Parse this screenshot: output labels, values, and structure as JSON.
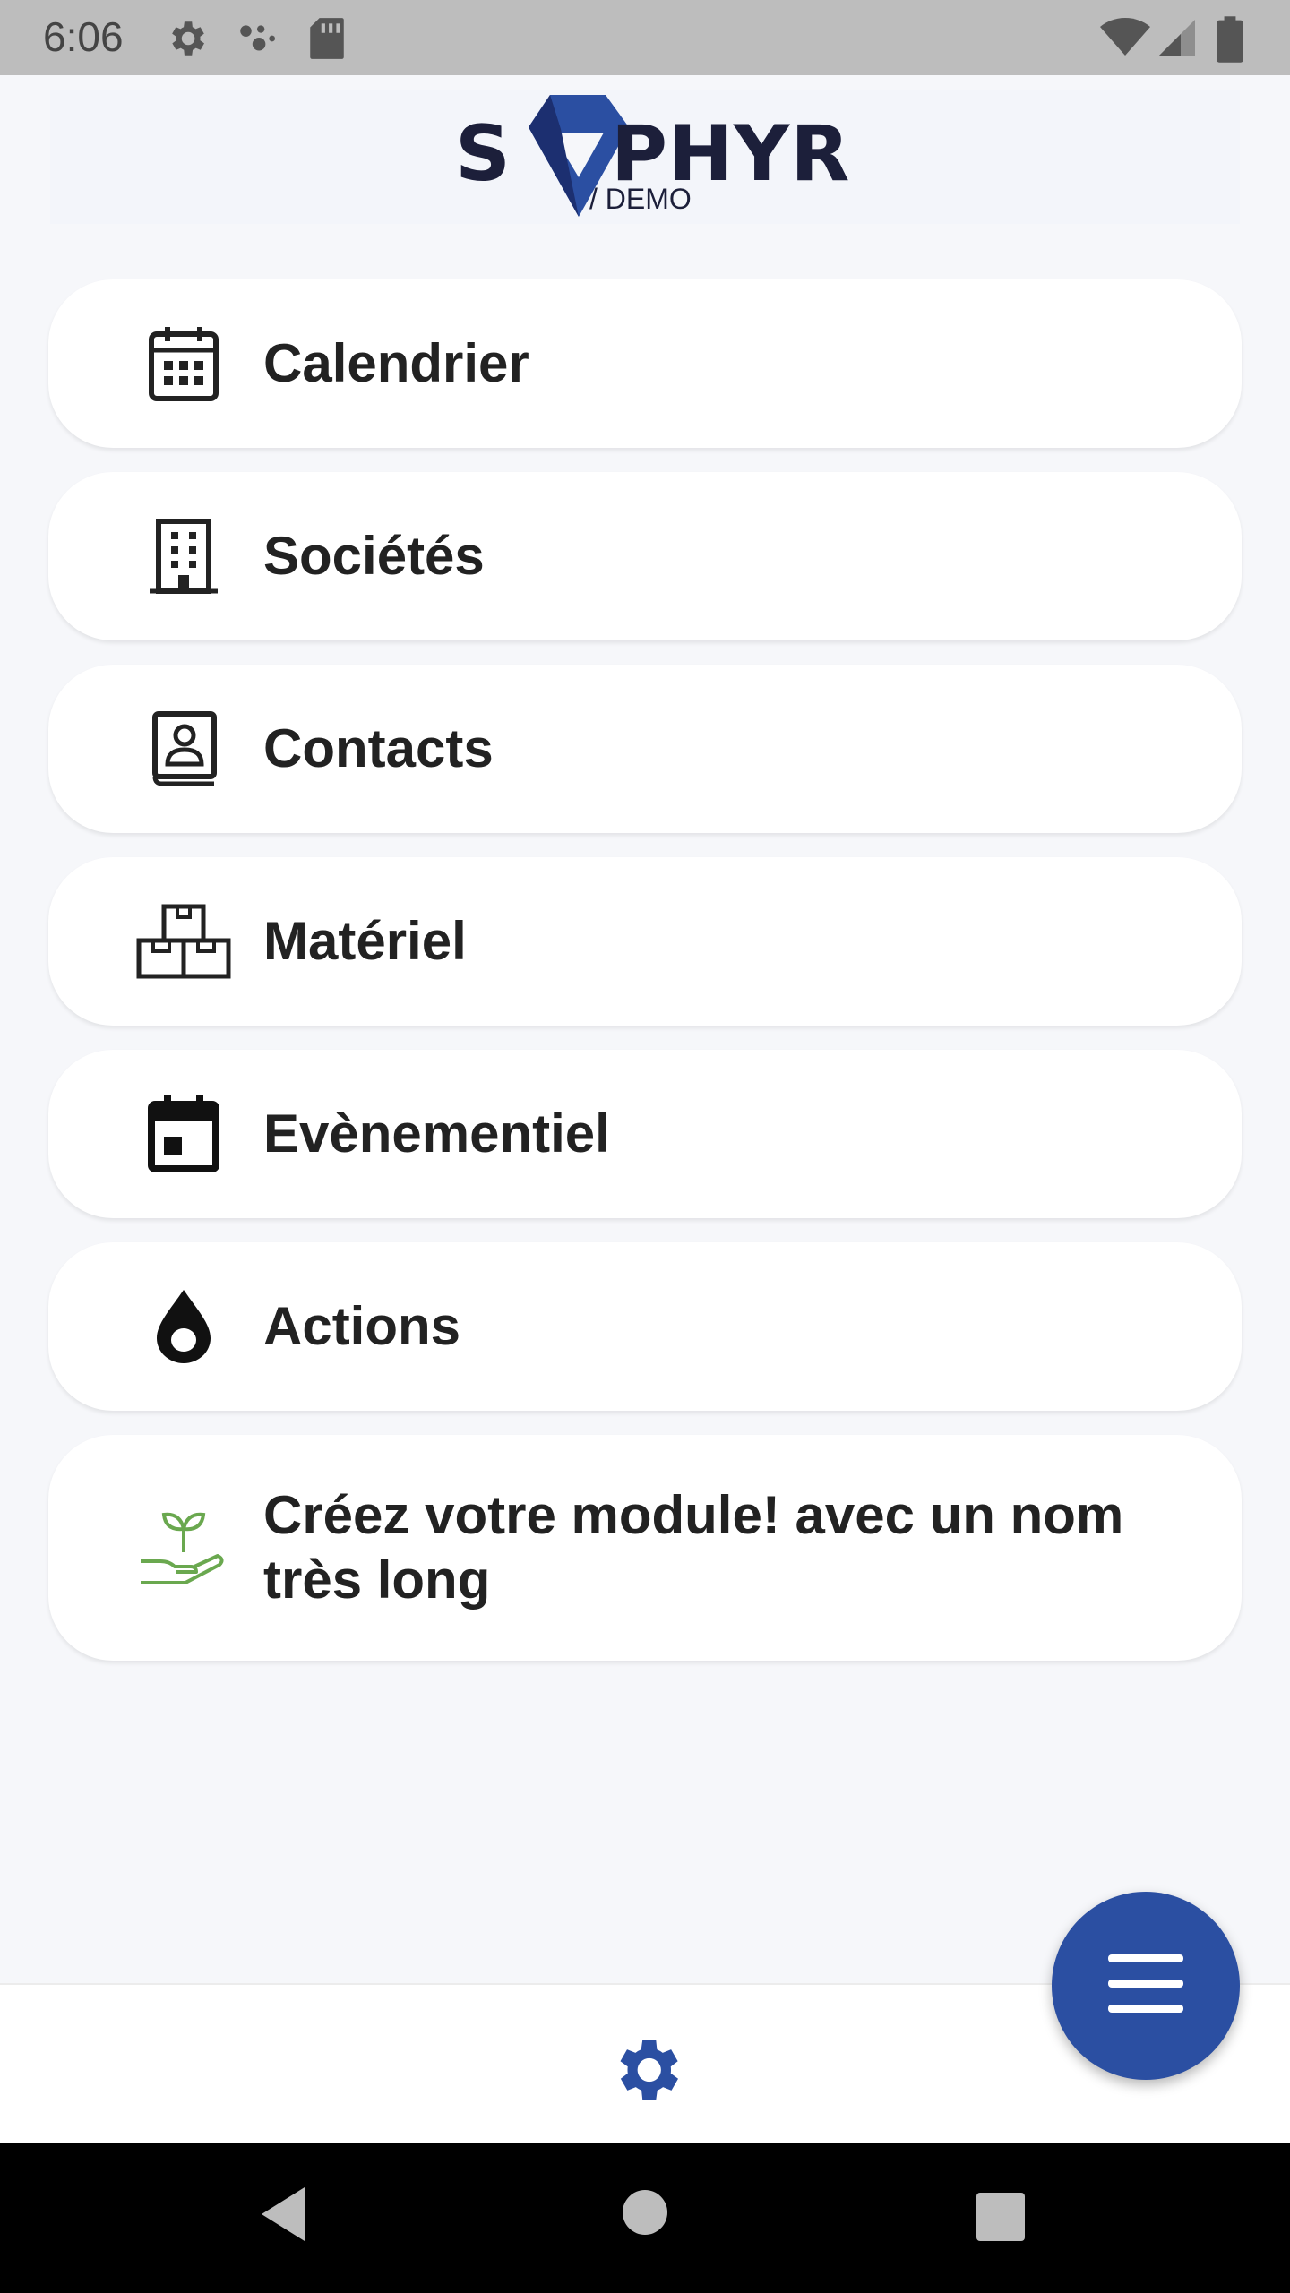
{
  "status_bar": {
    "time": "6:06",
    "icons": [
      "settings-icon",
      "assistant-icon",
      "sd-card-icon",
      "wifi-icon",
      "signal-icon",
      "battery-icon"
    ]
  },
  "header": {
    "logo_main": "S PHYR",
    "logo_s": "S",
    "logo_rest": "PHYR",
    "logo_sub": "/ DEMO"
  },
  "menu": {
    "items": [
      {
        "label": "Calendrier",
        "icon": "calendar-icon"
      },
      {
        "label": "Sociétés",
        "icon": "building-icon"
      },
      {
        "label": "Contacts",
        "icon": "contact-book-icon"
      },
      {
        "label": "Matériel",
        "icon": "boxes-icon"
      },
      {
        "label": "Evènementiel",
        "icon": "event-icon"
      },
      {
        "label": "Actions",
        "icon": "drop-icon"
      },
      {
        "label": "Créez votre module! avec un nom très long",
        "icon": "plant-hand-icon"
      }
    ]
  },
  "bottom_bar": {
    "icon": "gear-icon"
  },
  "fab": {
    "icon": "menu-icon"
  },
  "colors": {
    "accent": "#2b4fa2",
    "background": "#f6f7fa",
    "card": "#ffffff",
    "green_icon": "#6aa84f"
  }
}
